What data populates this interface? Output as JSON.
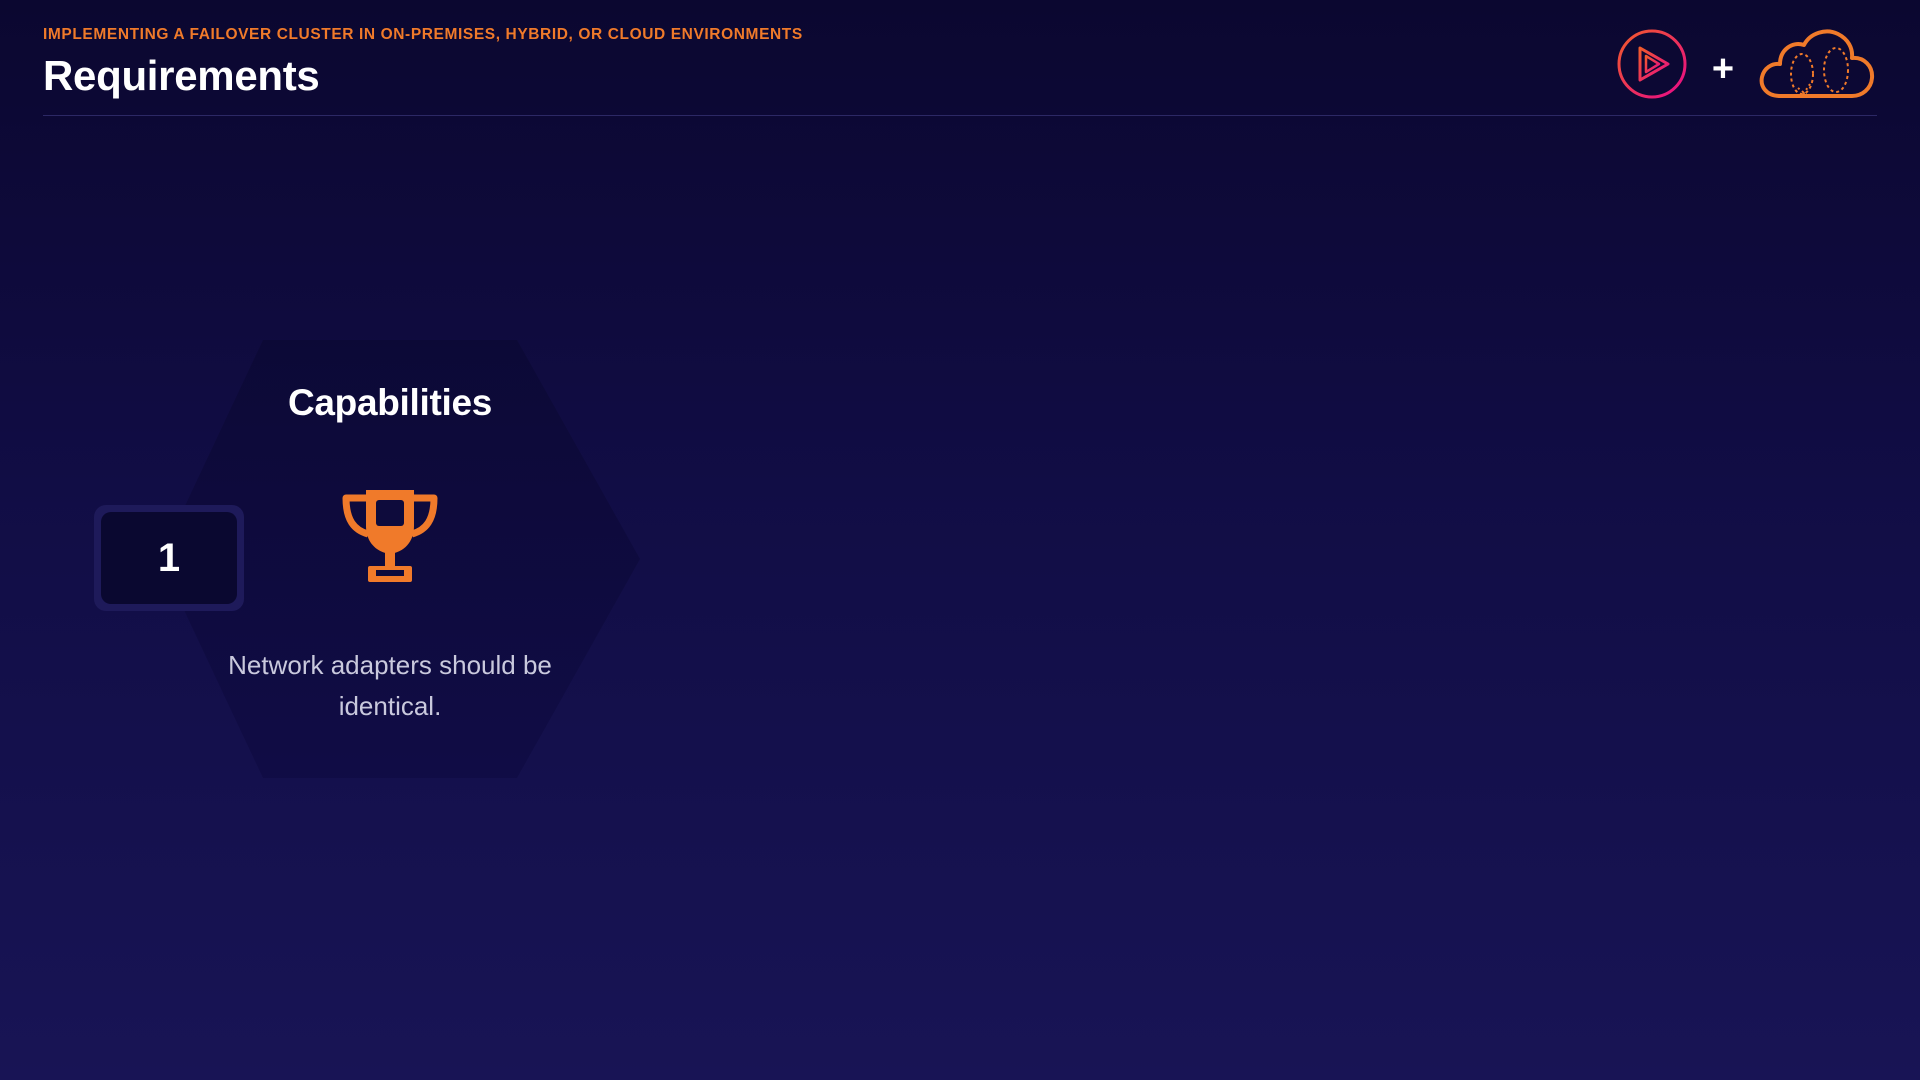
{
  "header": {
    "kicker": "IMPLEMENTING A FAILOVER CLUSTER IN ON-PREMISES, HYBRID, OR CLOUD ENVIRONMENTS",
    "title": "Requirements",
    "plus": "+"
  },
  "brand": {
    "play_logo_icon": "play-circle-icon",
    "cloud_logo_icon": "cloud-icon",
    "colors": {
      "play_gradient_start": "#f15b2a",
      "play_gradient_end": "#e80a89",
      "cloud": "#f07a2a"
    }
  },
  "card": {
    "title": "Capabilities",
    "icon": "trophy-icon",
    "description": "Network adapters should be identical.",
    "number": "1"
  },
  "colors": {
    "accent": "#f07a2a",
    "background_top": "#0b0730",
    "background_bottom": "#181455",
    "hexagon": "#0e0b3c"
  }
}
